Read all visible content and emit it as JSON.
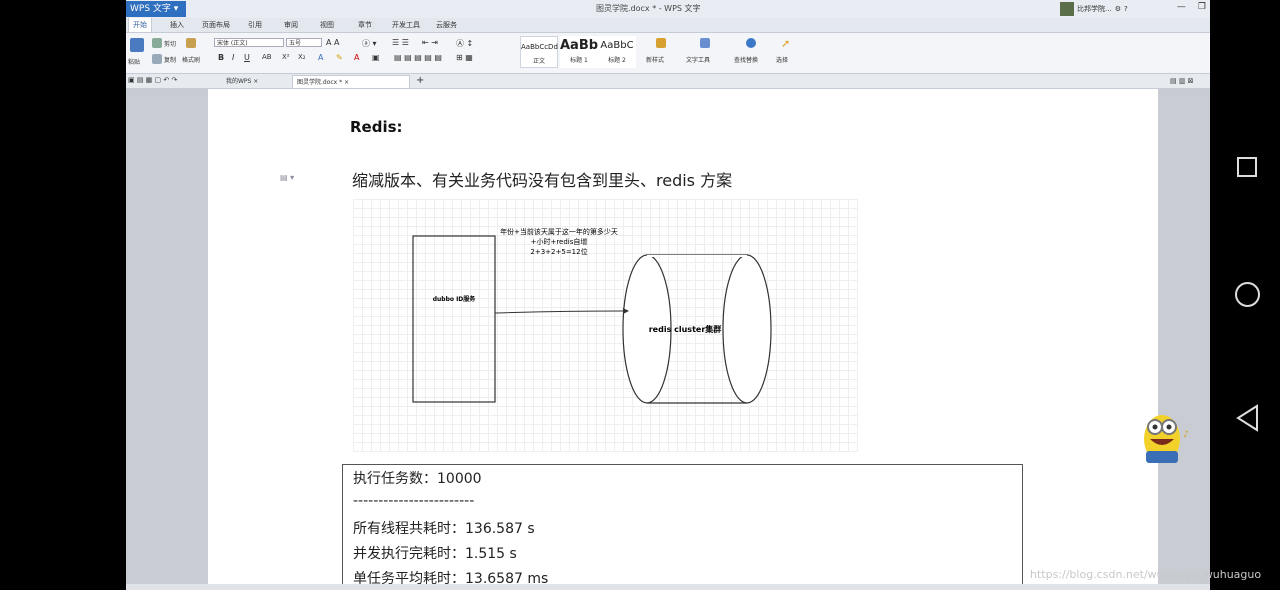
{
  "app": {
    "name": "WPS 文字",
    "doc_title": "图灵学院.docx * - WPS 文字",
    "user_name": "比邦学院..."
  },
  "menu": [
    "开始",
    "插入",
    "页面布局",
    "引用",
    "审阅",
    "视图",
    "章节",
    "开发工具",
    "云服务"
  ],
  "ribbon": {
    "paste_label": "粘贴",
    "cut_label": "剪切",
    "copy_label": "复制",
    "format_painter_label": "格式刷",
    "font_name": "宋体 (正文)",
    "font_size": "五号",
    "styles": [
      {
        "sample": "AaBbCcDd",
        "caption": "正文"
      },
      {
        "sample": "AaBb",
        "caption": "标题 1"
      },
      {
        "sample": "AaBbC",
        "caption": "标题 2"
      }
    ],
    "new_style_label": "新样式",
    "text_tools_label": "文字工具",
    "find_replace_label": "查找替换",
    "select_label": "选择"
  },
  "tabs": [
    {
      "label": "我的WPS"
    },
    {
      "label": "图灵学院.docx *"
    }
  ],
  "document": {
    "heading": "Redis:",
    "paragraph": "缩减版本、有关业务代码没有包含到里头、redis 方案",
    "diagram": {
      "service_label": "dubbo ID服务",
      "cluster_label": "redis cluster集群",
      "annotation": [
        "年份+当前该天属于这一年的第多少天",
        "+小时+redis自增",
        "2+3+2+5=12位"
      ]
    },
    "results": [
      "执行任务数：10000",
      "------------------------",
      "所有线程共耗时：136.587 s",
      "并发执行完耗时：1.515 s",
      "单任务平均耗时：13.6587 ms"
    ]
  },
  "watermark": "https://blog.csdn.net/wuhuagu_wuhuaguo",
  "colors": {
    "app_button": "#2f6fbf",
    "page": "#ffffff",
    "canvas": "#c9cdd3"
  }
}
